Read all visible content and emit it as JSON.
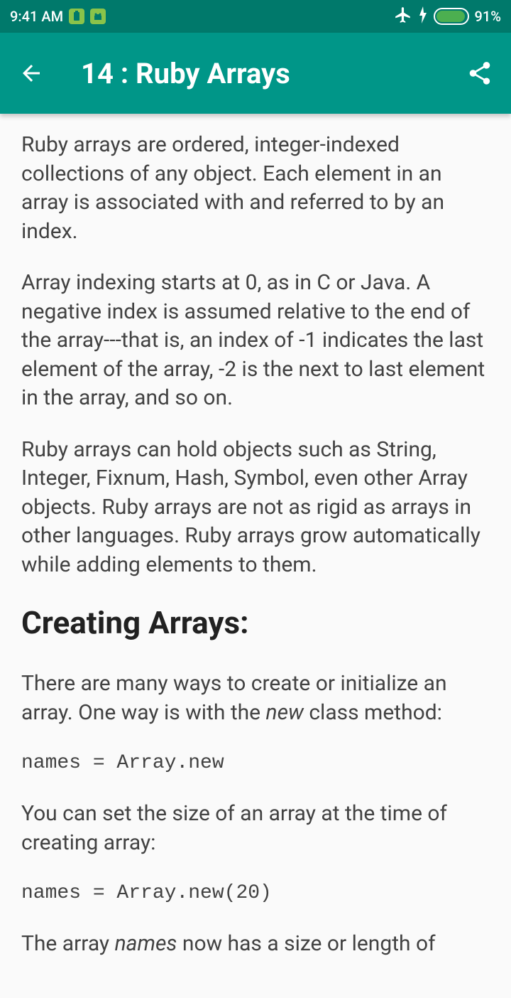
{
  "status_bar": {
    "time": "9:41 AM",
    "battery_percent": "91%"
  },
  "app_bar": {
    "title": "14 : Ruby Arrays"
  },
  "content": {
    "p1": "Ruby arrays are ordered, integer-indexed collections of any object. Each element in an array is associated with and referred to by an index.",
    "p2": "Array indexing starts at 0, as in C or Java. A negative index is assumed relative to the end of the array---that is, an index of -1 indicates the last element of the array, -2 is the next to last element in the array, and so on.",
    "p3": "Ruby arrays can hold objects such as String, Integer, Fixnum, Hash, Symbol, even other Array objects. Ruby arrays are not as rigid as arrays in other languages. Ruby arrays grow automatically while adding elements to them.",
    "h1": "Creating Arrays:",
    "p4_pre": "There are many ways to create or initialize an array. One way is with the ",
    "p4_italic": "new",
    "p4_post": " class method:",
    "code1": "names = Array.new",
    "p5": "You can set the size of an array at the time of creating array:",
    "code2": "names = Array.new(20)",
    "p6_pre": "The array ",
    "p6_italic": "names",
    "p6_post": " now has a size or length of"
  }
}
